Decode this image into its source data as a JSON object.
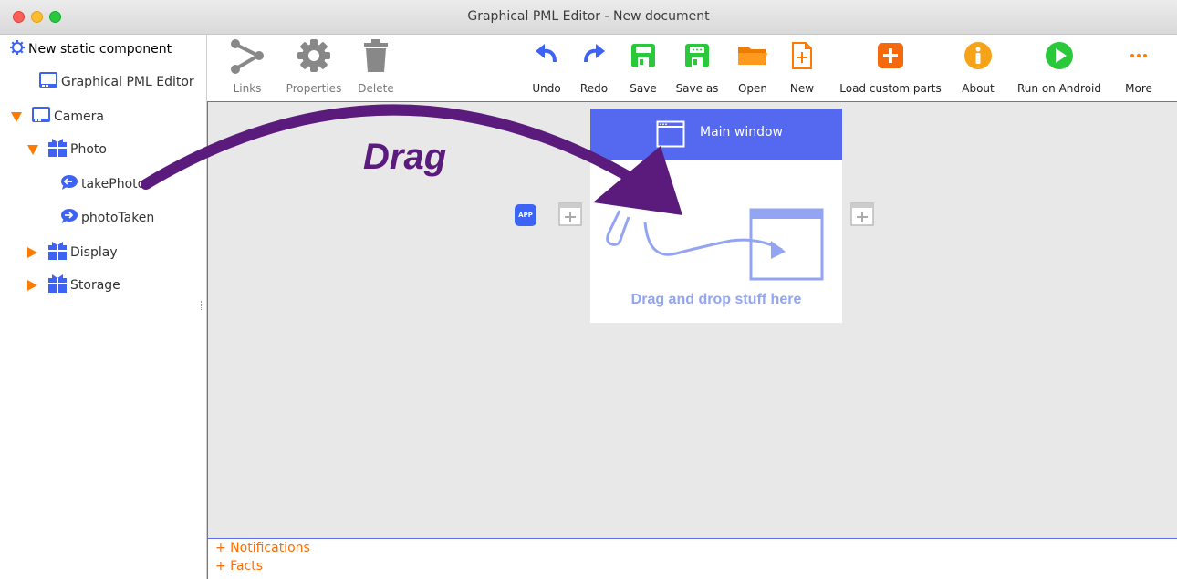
{
  "window": {
    "title": "Graphical PML Editor - New document"
  },
  "sidebar": {
    "items": [
      {
        "label": "New static component"
      },
      {
        "label": "Graphical PML Editor"
      },
      {
        "label": "Camera"
      },
      {
        "label": "Photo"
      },
      {
        "label": "takePhoto"
      },
      {
        "label": "photoTaken"
      },
      {
        "label": "Display"
      },
      {
        "label": "Storage"
      }
    ]
  },
  "toolbar": {
    "links": "Links",
    "properties": "Properties",
    "delete": "Delete",
    "undo": "Undo",
    "redo": "Redo",
    "save": "Save",
    "save_as": "Save as",
    "open": "Open",
    "new": "New",
    "load_custom_parts": "Load custom parts",
    "about": "About",
    "run_on_android": "Run on Android",
    "more": "More"
  },
  "canvas": {
    "main_window_title": "Main window",
    "drop_hint": "Drag and drop stuff here",
    "app_badge": "APP"
  },
  "overlay": {
    "drag_label": "Drag"
  },
  "bottom": {
    "notifications": "+ Notifications",
    "facts": "+ Facts"
  },
  "colors": {
    "accent": "#5468f0",
    "orange": "#ff7a00",
    "green": "#2cc83c",
    "purple": "#5a1b7d"
  }
}
